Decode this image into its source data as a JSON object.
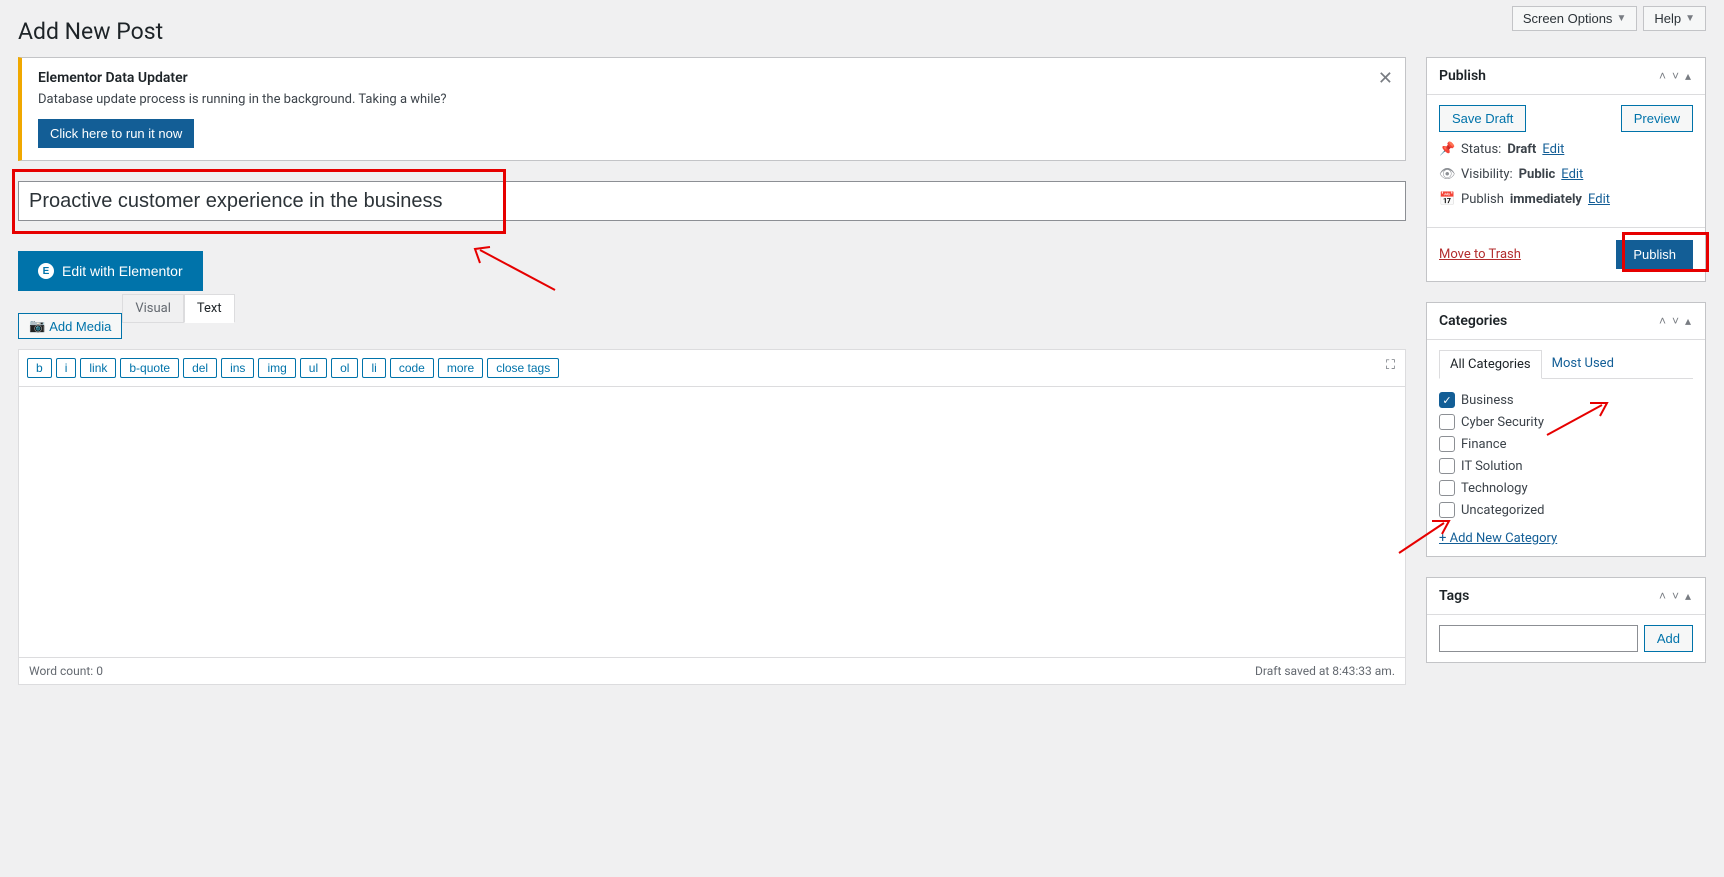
{
  "top": {
    "screen_options": "Screen Options",
    "help": "Help"
  },
  "page_title": "Add New Post",
  "notice": {
    "title": "Elementor Data Updater",
    "message": "Database update process is running in the background. Taking a while?",
    "button": "Click here to run it now"
  },
  "post_title": "Proactive customer experience in the business",
  "elementor_button": "Edit with Elementor",
  "add_media": "Add Media",
  "editor_tabs": {
    "visual": "Visual",
    "text": "Text"
  },
  "quicktags": [
    "b",
    "i",
    "link",
    "b-quote",
    "del",
    "ins",
    "img",
    "ul",
    "ol",
    "li",
    "code",
    "more",
    "close tags"
  ],
  "status_bar": {
    "word_count_label": "Word count: ",
    "word_count": "0",
    "draft_saved": "Draft saved at 8:43:33 am."
  },
  "publish": {
    "title": "Publish",
    "save_draft": "Save Draft",
    "preview": "Preview",
    "status_label": "Status:",
    "status_value": "Draft",
    "visibility_label": "Visibility:",
    "visibility_value": "Public",
    "publish_label": "Publish",
    "publish_value": "immediately",
    "edit": "Edit",
    "trash": "Move to Trash",
    "publish_button": "Publish"
  },
  "categories": {
    "title": "Categories",
    "tab_all": "All Categories",
    "tab_most": "Most Used",
    "items": [
      {
        "label": "Business",
        "checked": true
      },
      {
        "label": "Cyber Security",
        "checked": false
      },
      {
        "label": "Finance",
        "checked": false
      },
      {
        "label": "IT Solution",
        "checked": false
      },
      {
        "label": "Technology",
        "checked": false
      },
      {
        "label": "Uncategorized",
        "checked": false
      }
    ],
    "add_new": "+ Add New Category"
  },
  "tags": {
    "title": "Tags",
    "add": "Add"
  }
}
